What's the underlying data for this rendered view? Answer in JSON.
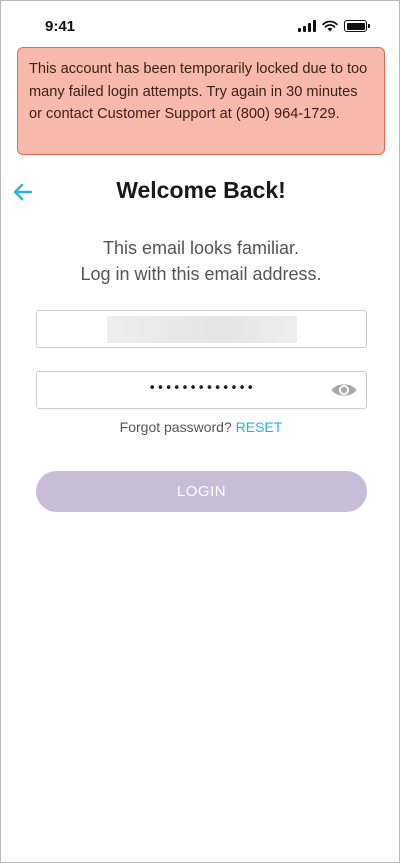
{
  "status_bar": {
    "time": "9:41"
  },
  "alert": {
    "message": "This account has been temporarily locked due to too many failed login attempts. Try again in 30 minutes or contact Customer Support at (800) 964-1729.",
    "color": "#f7b9ab"
  },
  "header": {
    "back_icon": "arrow-left-icon",
    "title": "Welcome Back!"
  },
  "subtitle": {
    "line1": "This email looks familiar.",
    "line2": "Log in with this email address."
  },
  "email_field": {
    "value": ""
  },
  "password_field": {
    "masked_value": "•••••••••••••",
    "toggle_icon": "eye-icon"
  },
  "forgot": {
    "prompt": "Forgot password?",
    "link": "RESET",
    "link_color": "#2bb3dd"
  },
  "login_button": {
    "label": "LOGIN",
    "color": "#c9bcd8"
  }
}
